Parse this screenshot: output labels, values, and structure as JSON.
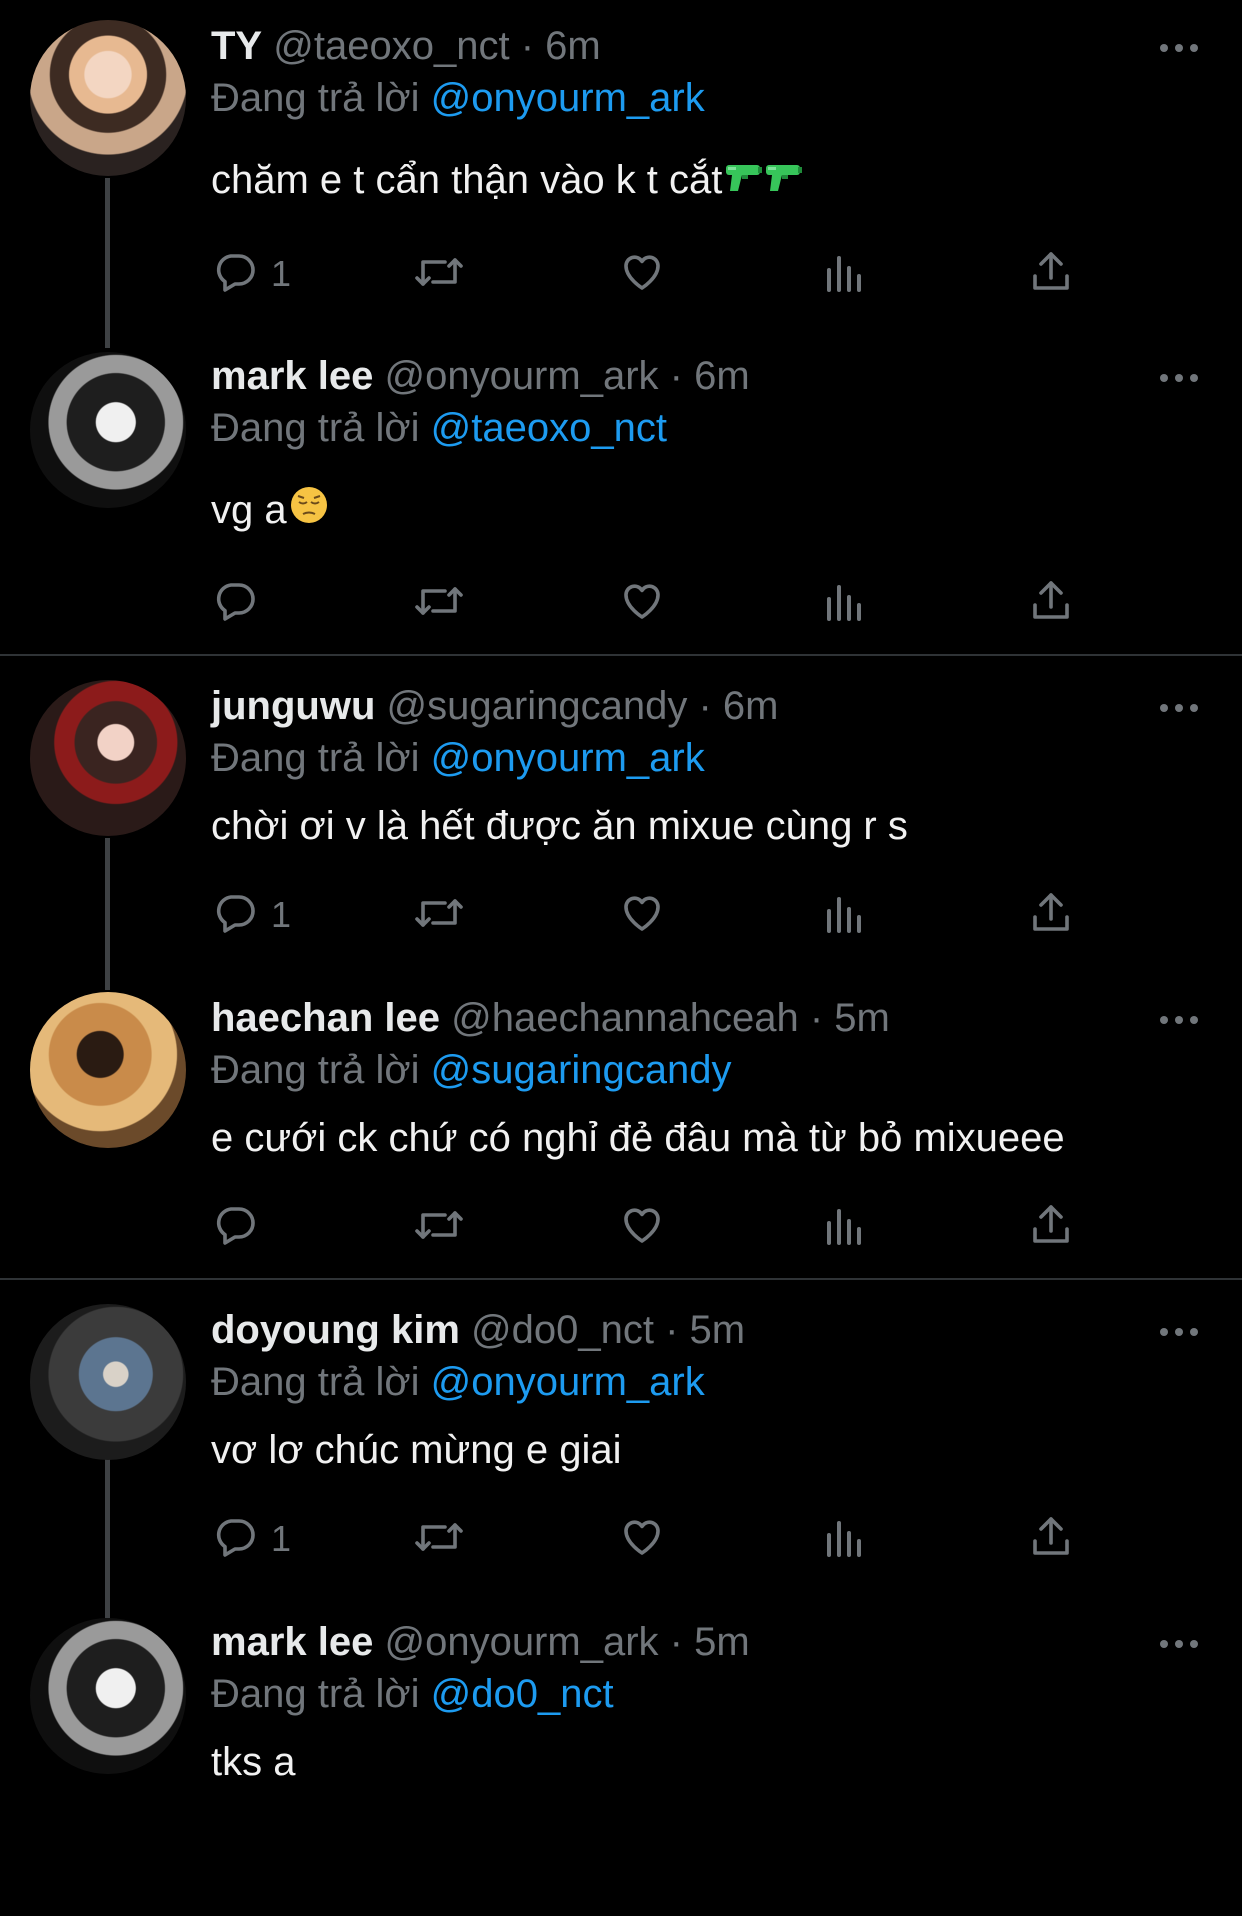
{
  "tweets": [
    {
      "name": "TY",
      "handle": "@taeoxo_nct",
      "time": "· 6m",
      "replying_label": "Đang trả lời",
      "replying_to": "@onyourm_ark",
      "text": "chăm e t cẩn thận vào k t cắt",
      "emoji": "water-pistol-icon x2",
      "reply_count": "1"
    },
    {
      "name": "mark lee",
      "handle": "@onyourm_ark",
      "time": "· 6m",
      "replying_label": "Đang trả lời",
      "replying_to": "@taeoxo_nct",
      "text": "vg a",
      "emoji": "pensive-face-icon",
      "reply_count": ""
    },
    {
      "name": "junguwu",
      "handle": "@sugaringcandy",
      "time": "· 6m",
      "replying_label": "Đang trả lời",
      "replying_to": "@onyourm_ark",
      "text": "chời ơi v là hết được ăn mixue cùng r s",
      "reply_count": "1"
    },
    {
      "name": "haechan lee",
      "handle": "@haechannahceah",
      "time": "· 5m",
      "replying_label": "Đang trả lời",
      "replying_to": "@sugaringcandy",
      "text": "e cưới ck chứ có nghỉ đẻ đâu mà từ bỏ mixueee",
      "reply_count": ""
    },
    {
      "name": "doyoung kim",
      "handle": "@do0_nct",
      "time": "· 5m",
      "replying_label": "Đang trả lời",
      "replying_to": "@onyourm_ark",
      "text": "vơ lơ chúc mừng e giai",
      "reply_count": "1"
    },
    {
      "name": "mark lee",
      "handle": "@onyourm_ark",
      "time": "· 5m",
      "replying_label": "Đang trả lời",
      "replying_to": "@do0_nct",
      "text": "tks a",
      "reply_count": ""
    }
  ],
  "colors": {
    "background": "#000000",
    "text": "#e7e9ea",
    "secondary": "#71767b",
    "mention": "#1d9bf0",
    "divider": "#2f3336"
  },
  "icons": [
    "reply-icon",
    "retweet-icon",
    "like-icon",
    "views-icon",
    "share-icon",
    "more-icon"
  ]
}
